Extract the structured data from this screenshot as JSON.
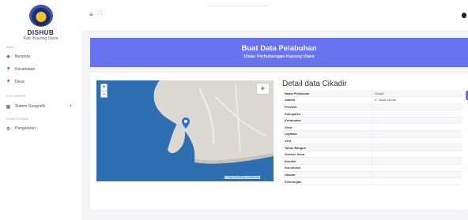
{
  "sidebar": {
    "brand_title": "DISHUB",
    "brand_sub": "Kab. Kayong Utara",
    "sections": {
      "main": "MAIN",
      "layers": "GIS LAYERS",
      "settings": "PENGATURAN"
    },
    "items": [
      {
        "label": "Beranda",
        "icon": "dashboard-icon"
      },
      {
        "label": "Kecamatan",
        "icon": "pin-icon"
      },
      {
        "label": "Desa",
        "icon": "pin-icon"
      },
      {
        "label": "Sistem Geografis",
        "icon": "map-icon",
        "caret": "+"
      },
      {
        "label": "Pengaturan",
        "icon": "gear-icon"
      }
    ]
  },
  "topbar": {
    "menu_icon": "≡",
    "expand_icon": "⛶"
  },
  "header": {
    "title": "Buat Data Pelabuhan",
    "subtitle": "Dinas Perhubungan Kayong Utara"
  },
  "map": {
    "zoom_in": "+",
    "zoom_out": "−",
    "attribution": "© OpenStreetMap contributors",
    "water_color": "#2d6fb0",
    "land_color": "#dcd8d2",
    "marker_color": "#2a6fd6"
  },
  "detail": {
    "title": "Detail data Cikadir",
    "rows": [
      {
        "key": "Nama Pelabuhan",
        "value": "Cikadir"
      },
      {
        "key": "Alamat",
        "value": "Jl. Tanah Merah"
      },
      {
        "key": "Provinsi",
        "value": ":"
      },
      {
        "key": "Kabupaten",
        "value": ":"
      },
      {
        "key": "Kecamatan",
        "value": ":"
      },
      {
        "key": "Desa",
        "value": ":"
      },
      {
        "key": "Layanan",
        "value": ":"
      },
      {
        "key": "Aset",
        "value": ":"
      },
      {
        "key": "Tahun Bangun",
        "value": ":"
      },
      {
        "key": "Sumber Dana",
        "value": ":"
      },
      {
        "key": "Kondisi",
        "value": ":"
      },
      {
        "key": "Konstruksi",
        "value": ":"
      },
      {
        "key": "Ukuran",
        "value": ":"
      },
      {
        "key": "Keterangan",
        "value": ":"
      }
    ]
  },
  "colors": {
    "accent": "#6a73ef",
    "sidebar_bg": "#ffffff",
    "page_bg": "#f4f5f8"
  }
}
